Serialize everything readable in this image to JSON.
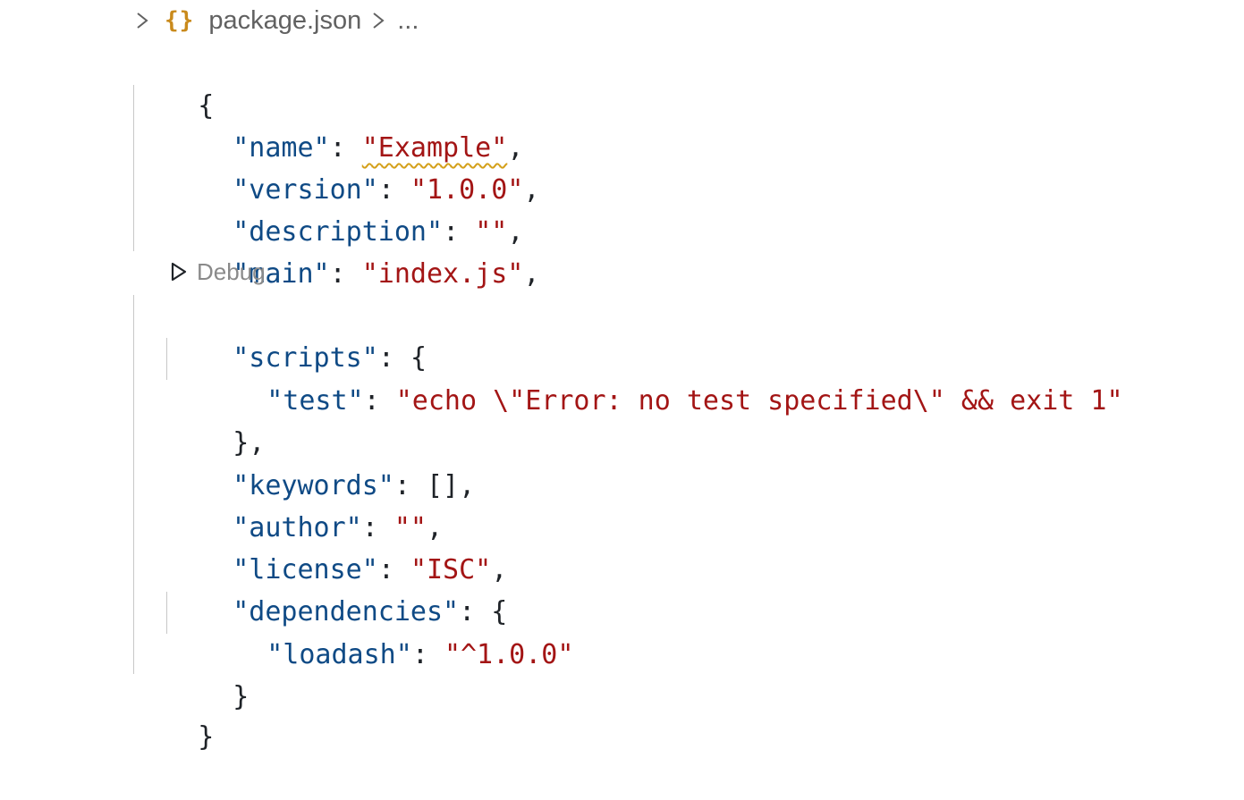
{
  "breadcrumb": {
    "file_icon": "json-braces-icon",
    "file_icon_glyph": "{}",
    "filename": "package.json",
    "ellipsis": "..."
  },
  "codelens": {
    "label": "Debug",
    "icon": "play-outline-icon"
  },
  "code": {
    "open_brace": "{",
    "name": {
      "key": "\"name\"",
      "value": "\"Example\""
    },
    "version": {
      "key": "\"version\"",
      "value": "\"1.0.0\""
    },
    "description": {
      "key": "\"description\"",
      "value": "\"\""
    },
    "main": {
      "key": "\"main\"",
      "value": "\"index.js\""
    },
    "scripts": {
      "key": "\"scripts\"",
      "open": "{",
      "test_key": "\"test\"",
      "test_value": "\"echo \\\"Error: no test specified\\\" && exit 1\"",
      "close": "},"
    },
    "keywords": {
      "key": "\"keywords\"",
      "value": "[],"
    },
    "author": {
      "key": "\"author\"",
      "value": "\"\""
    },
    "license": {
      "key": "\"license\"",
      "value": "\"ISC\""
    },
    "dependencies": {
      "key": "\"dependencies\"",
      "open": "{",
      "dep_key": "\"loadash\"",
      "dep_value": "\"^1.0.0\"",
      "close": "}"
    },
    "close_brace": "}"
  },
  "colors": {
    "key": "#0f4a85",
    "string": "#a31515",
    "punctuation": "#1f2328",
    "warning_squiggle": "#d4a01a",
    "json_icon": "#c98a1c"
  }
}
